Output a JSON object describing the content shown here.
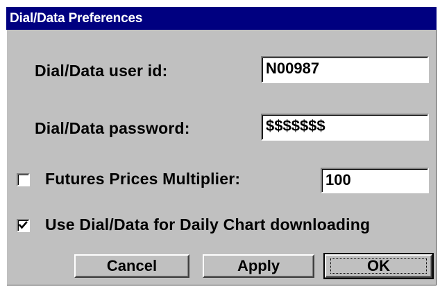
{
  "window": {
    "title": "Dial/Data Preferences"
  },
  "fields": {
    "user_id_label": "Dial/Data user id:",
    "user_id_value": "N00987",
    "password_label": "Dial/Data password:",
    "password_value": "$$$$$$$",
    "multiplier_label": "Futures Prices Multiplier:",
    "multiplier_value": "100"
  },
  "checkboxes": {
    "multiplier_checked": false,
    "daily_chart_label": "Use Dial/Data for Daily Chart downloading",
    "daily_chart_checked": true
  },
  "buttons": {
    "cancel_label": "Cancel",
    "apply_label": "Apply",
    "ok_label": "OK"
  },
  "colors": {
    "titlebar": "#000080",
    "face": "#c0c0c0"
  }
}
